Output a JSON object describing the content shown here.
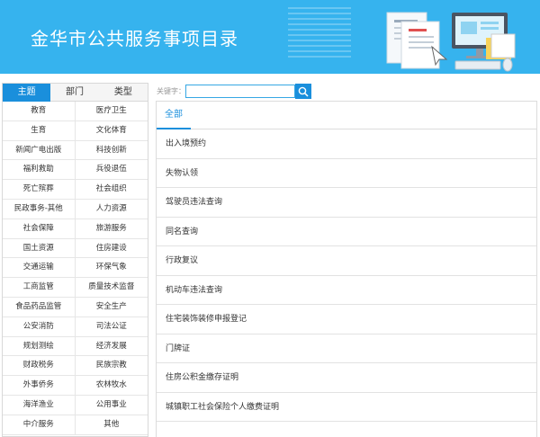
{
  "header": {
    "title": "金华市公共服务事项目录"
  },
  "sidebar": {
    "tabs": [
      "主题",
      "部门",
      "类型"
    ],
    "categories": [
      "教育",
      "医疗卫生",
      "生育",
      "文化体育",
      "新闻广电出版",
      "科技创新",
      "福利救助",
      "兵役退伍",
      "死亡殡葬",
      "社会组织",
      "民政事务-其他",
      "人力资源",
      "社会保障",
      "旅游服务",
      "国土资源",
      "住房建设",
      "交通运输",
      "环保气象",
      "工商监管",
      "质量技术监督",
      "食品药品监管",
      "安全生产",
      "公安消防",
      "司法公证",
      "规划测绘",
      "经济发展",
      "财政税务",
      "民族宗教",
      "外事侨务",
      "农林牧水",
      "海洋渔业",
      "公用事业",
      "中介服务",
      "其他"
    ]
  },
  "search": {
    "label": "关键字：",
    "placeholder": "",
    "value": ""
  },
  "main": {
    "active_tab": "全部",
    "items": [
      "出入境预约",
      "失物认领",
      "驾驶员违法查询",
      "同名查询",
      "行政复议",
      "机动车违法查询",
      "住宅装饰装修申报登记",
      "门牌证",
      "住房公积金缴存证明",
      "城镇职工社会保险个人缴费证明"
    ]
  },
  "colors": {
    "banner": "#36b3ee",
    "accent": "#1a8fdc"
  },
  "icons": {
    "search": "magnifier-icon"
  }
}
